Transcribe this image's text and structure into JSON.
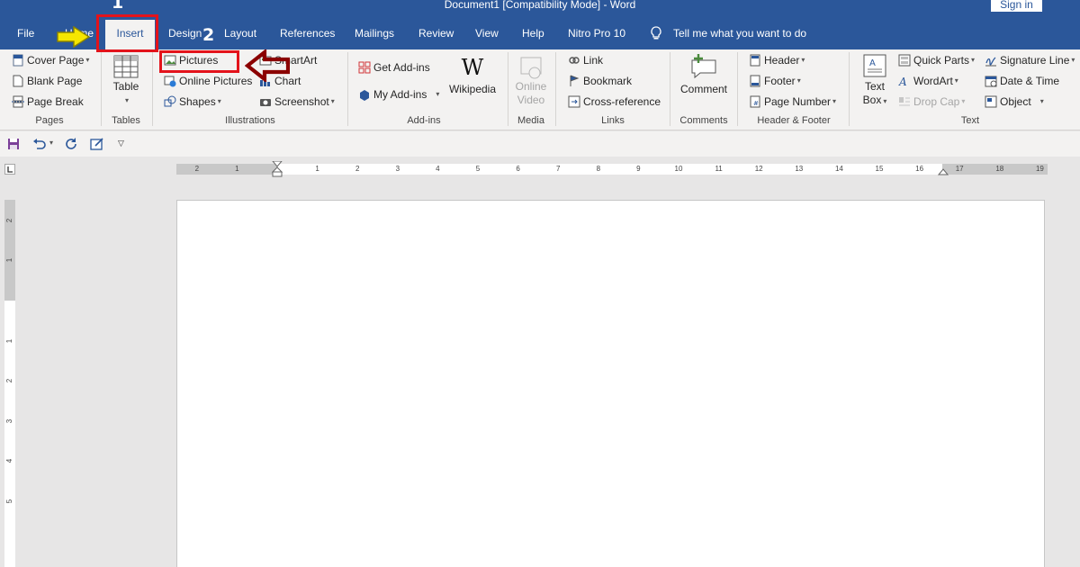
{
  "window": {
    "title": "Document1 [Compatibility Mode]  -  Word",
    "signin_label": "Sign in"
  },
  "tabs": {
    "file": "File",
    "home": "Home",
    "insert": "Insert",
    "design": "Design",
    "layout": "Layout",
    "references": "References",
    "mailings": "Mailings",
    "review": "Review",
    "view": "View",
    "help": "Help",
    "nitro": "Nitro Pro 10",
    "tell_me": "Tell me what you want to do"
  },
  "ribbon": {
    "pages": {
      "cover_page": "Cover Page",
      "blank_page": "Blank Page",
      "page_break": "Page Break",
      "label": "Pages"
    },
    "tables": {
      "table": "Table",
      "label": "Tables"
    },
    "illustrations": {
      "pictures": "Pictures",
      "online_pictures": "Online Pictures",
      "shapes": "Shapes",
      "smartart": "SmartArt",
      "chart": "Chart",
      "screenshot": "Screenshot",
      "label": "Illustrations"
    },
    "addins": {
      "get_addins": "Get Add-ins",
      "my_addins": "My Add-ins",
      "wikipedia": "Wikipedia",
      "label": "Add-ins"
    },
    "media": {
      "online_video_1": "Online",
      "online_video_2": "Video",
      "label": "Media"
    },
    "links": {
      "link": "Link",
      "bookmark": "Bookmark",
      "cross_reference": "Cross-reference",
      "label": "Links"
    },
    "comments": {
      "comment": "Comment",
      "label": "Comments"
    },
    "header_footer": {
      "header": "Header",
      "footer": "Footer",
      "page_number": "Page Number",
      "label": "Header & Footer"
    },
    "text": {
      "text_box_1": "Text",
      "text_box_2": "Box",
      "quick_parts": "Quick Parts",
      "wordart": "WordArt",
      "drop_cap": "Drop Cap",
      "signature_line": "Signature Line",
      "date_time": "Date & Time",
      "object": "Object",
      "label": "Text"
    }
  },
  "annotations": {
    "step1": "1",
    "step2": "2"
  },
  "ruler": {
    "h_labels": [
      "2",
      "1",
      "1",
      "2",
      "3",
      "4",
      "5",
      "6",
      "7",
      "8",
      "9",
      "10",
      "11",
      "12",
      "13",
      "14",
      "15",
      "16",
      "17",
      "18",
      "19"
    ],
    "v_labels": [
      "2",
      "1",
      "1",
      "2",
      "3",
      "4",
      "5"
    ]
  },
  "colors": {
    "word_blue": "#2b579a",
    "highlight_red": "#e3131b",
    "arrow_yellow": "#f5e600",
    "arrow_dark_red": "#8b0000"
  }
}
